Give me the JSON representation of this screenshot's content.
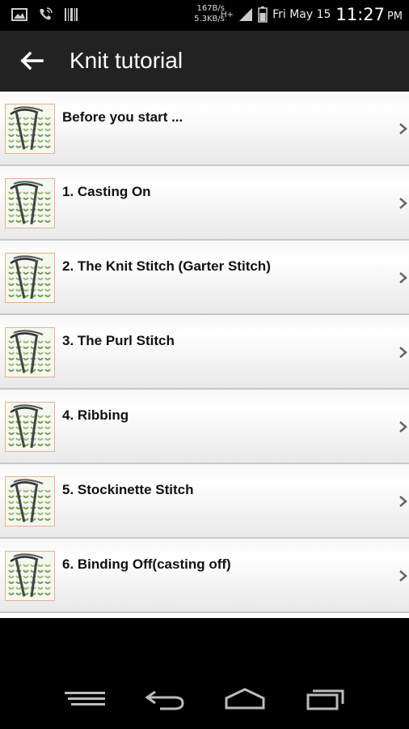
{
  "status_bar": {
    "speed_up": "167B/s",
    "speed_down": "5.3KB/s",
    "network": "H+",
    "date": "Fri May 15",
    "time": "11:27",
    "ampm": "PM"
  },
  "app_bar": {
    "title": "Knit tutorial"
  },
  "items": [
    {
      "label": "Before you start ..."
    },
    {
      "label": "1. Casting On"
    },
    {
      "label": "2. The Knit Stitch (Garter Stitch)"
    },
    {
      "label": "3. The Purl Stitch"
    },
    {
      "label": "4. Ribbing"
    },
    {
      "label": "5. Stockinette Stitch"
    },
    {
      "label": "6. Binding Off(casting off)"
    }
  ],
  "icons": {
    "thumbnail": "knitting-icon",
    "row_arrow": "chevron-right-icon"
  },
  "colors": {
    "app_bar": "#222222",
    "thumb_border": "#e6b08c"
  }
}
